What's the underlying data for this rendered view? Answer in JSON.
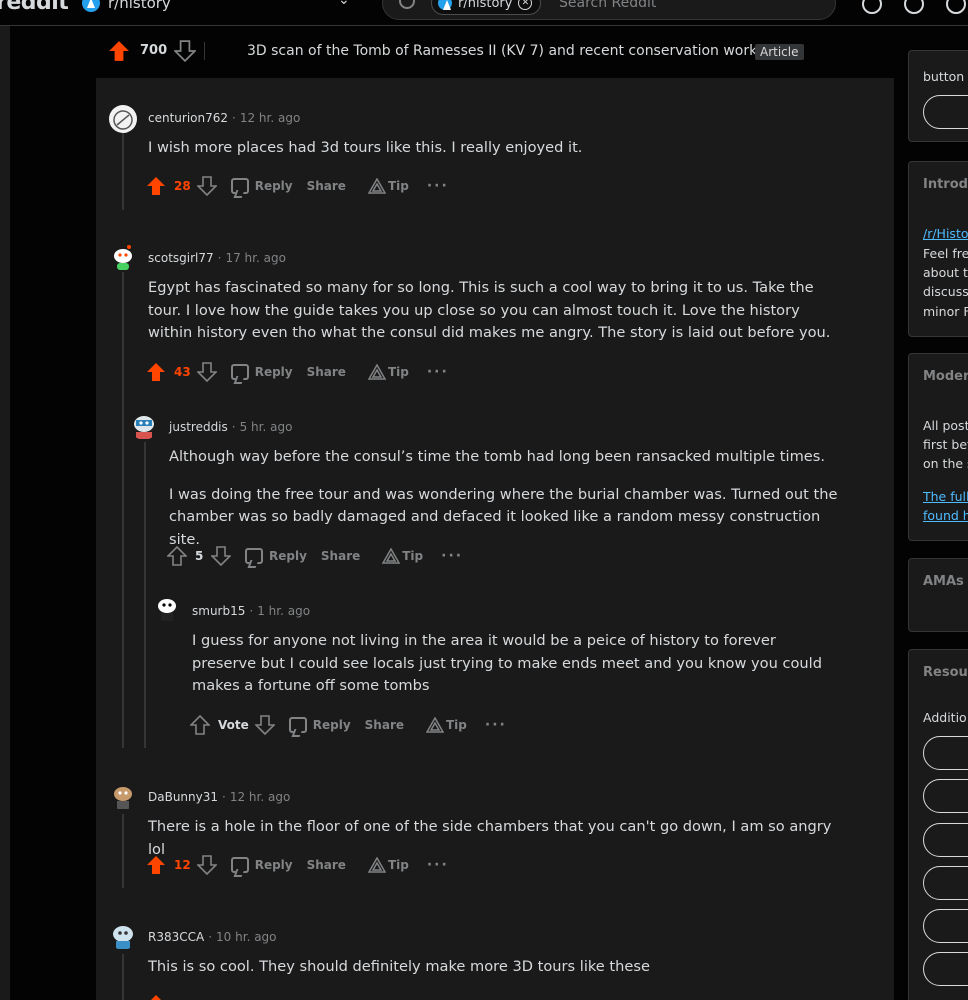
{
  "header": {
    "logo": "reddit",
    "subreddit": "r/history",
    "search_chip": "r/history",
    "search_placeholder": "Search Reddit"
  },
  "post": {
    "score": "700",
    "title": "3D scan of the Tomb of Ramesses II (KV 7) and recent conservation work",
    "flair": "Article"
  },
  "actions_labels": {
    "reply": "Reply",
    "share": "Share",
    "tip": "Tip",
    "more": "···",
    "vote": "Vote"
  },
  "colors": {
    "upvote": "#ff4500",
    "background": "#1a1a1b",
    "page": "#030303",
    "text": "#d7dadc",
    "muted": "#818384",
    "link": "#4fbcff"
  },
  "comments": [
    {
      "author": "centurion762",
      "time": "12 hr. ago",
      "score": "28",
      "voted": "up",
      "paragraphs": [
        "I wish more places had 3d tours like this. I really enjoyed it."
      ]
    },
    {
      "author": "scotsgirl77",
      "time": "17 hr. ago",
      "score": "43",
      "voted": "up",
      "paragraphs": [
        "Egypt has fascinated so many for so long. This is such a cool way to bring it to us. Take the tour. I love how the guide takes you up close so you can almost touch it. Love the history within history even tho what the consul did makes me angry. The story is laid out before you."
      ]
    },
    {
      "author": "justreddis",
      "time": "5 hr. ago",
      "score": "5",
      "voted": "none",
      "paragraphs": [
        "Although way before the consul’s time the tomb had long been ransacked multiple times.",
        "I was doing the free tour and was wondering where the burial chamber was. Turned out the chamber was so badly damaged and defaced it looked like a random messy construction site."
      ]
    },
    {
      "author": "smurb15",
      "time": "1 hr. ago",
      "score": "Vote",
      "voted": "none",
      "paragraphs": [
        "I guess for anyone not living in the area it would be a peice of history to forever preserve but I could see locals just trying to make ends meet and you know you could makes a fortune off some tombs"
      ]
    },
    {
      "author": "DaBunny31",
      "time": "12 hr. ago",
      "score": "12",
      "voted": "up",
      "paragraphs": [
        "There is a hole in the floor of one of the side chambers that you can't go down, I am so angry lol"
      ]
    },
    {
      "author": "R383CCA",
      "time": "10 hr. ago",
      "score": "",
      "voted": "up",
      "paragraphs": [
        "This is so cool. They should definitely make more 3D tours like these"
      ]
    }
  ],
  "sidebar": {
    "top_card_text": "button",
    "intro_heading": "Introd",
    "intro_link": "/r/Histo",
    "intro_lines": [
      "Feel fre",
      "about t",
      "discussi",
      "minor F"
    ],
    "mod_heading": "Moder",
    "mod_lines": [
      "All post",
      "first bef",
      "on the s"
    ],
    "mod_links": [
      "The full",
      "found h"
    ],
    "amas_heading": "AMAs",
    "resources_heading": "Resou",
    "resources_text": "Additio"
  }
}
